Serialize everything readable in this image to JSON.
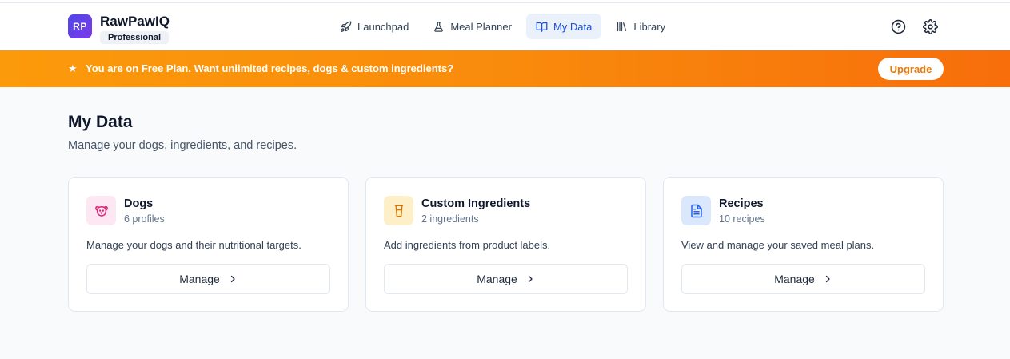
{
  "brand": {
    "logo_text": "RP",
    "name": "RawPawIQ",
    "plan": "Professional"
  },
  "nav": [
    {
      "label": "Launchpad",
      "icon": "rocket-icon",
      "active": false
    },
    {
      "label": "Meal Planner",
      "icon": "flask-icon",
      "active": false
    },
    {
      "label": "My Data",
      "icon": "book-open-icon",
      "active": true
    },
    {
      "label": "Library",
      "icon": "library-icon",
      "active": false
    }
  ],
  "header_icons": [
    "help-icon",
    "gear-icon"
  ],
  "banner": {
    "icon": "star-icon",
    "text": "You are on Free Plan. Want unlimited recipes, dogs & custom ingredients?",
    "button": "Upgrade"
  },
  "page": {
    "title": "My Data",
    "subtitle": "Manage your dogs, ingredients, and recipes."
  },
  "cards": [
    {
      "title": "Dogs",
      "count": "6 profiles",
      "description": "Manage your dogs and their nutritional targets.",
      "button": "Manage",
      "icon": "dog-icon",
      "icon_bg": "#fce7f3",
      "icon_color": "#db2777"
    },
    {
      "title": "Custom Ingredients",
      "count": "2 ingredients",
      "description": "Add ingredients from product labels.",
      "button": "Manage",
      "icon": "cup-icon",
      "icon_bg": "#fdefc8",
      "icon_color": "#d97706"
    },
    {
      "title": "Recipes",
      "count": "10 recipes",
      "description": "View and manage your saved meal plans.",
      "button": "Manage",
      "icon": "file-text-icon",
      "icon_bg": "#dbe7fb",
      "icon_color": "#2563eb"
    }
  ],
  "colors": {
    "accent": "#1d4ed8",
    "banner_start": "#fb9a0b",
    "banner_end": "#f76e0b",
    "logo_start": "#4f46e5",
    "logo_end": "#7c3aed"
  }
}
